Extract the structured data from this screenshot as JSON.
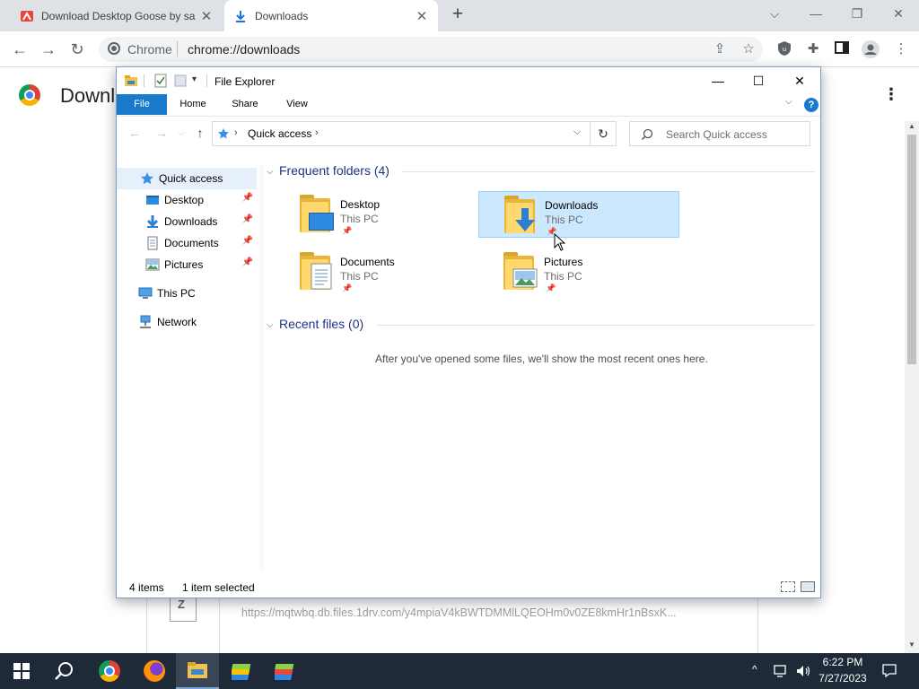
{
  "browser": {
    "tabs": [
      {
        "title": "Download Desktop Goose by sa",
        "close": "✕"
      },
      {
        "title": "Downloads",
        "close": "✕"
      }
    ],
    "new_tab": "+",
    "window_controls": {
      "dropdown": "⌵",
      "minimize": "—",
      "restore": "❐",
      "close": "✕"
    },
    "omnibox": {
      "site_label": "Chrome",
      "url": "chrome://downloads"
    }
  },
  "downloads_page": {
    "title": "Downloads",
    "item_url": "https://mqtwbq.db.files.1drv.com/y4mpiaV4kBWTDMMlLQEOHm0v0ZE8kmHr1nBsxK...",
    "file_icon_letter": "Z"
  },
  "explorer": {
    "title": "File Explorer",
    "window_controls": {
      "minimize": "—",
      "maximize": "☐",
      "close": "✕"
    },
    "ribbon": {
      "tabs": [
        "File",
        "Home",
        "Share",
        "View"
      ],
      "help": "?"
    },
    "address": {
      "location": "Quick access",
      "search_placeholder": "Search Quick access"
    },
    "nav": {
      "quick_access": "Quick access",
      "pinned": [
        "Desktop",
        "Downloads",
        "Documents",
        "Pictures"
      ],
      "this_pc": "This PC",
      "network": "Network"
    },
    "frequent": {
      "header": "Frequent folders (4)",
      "folders": [
        {
          "name": "Desktop",
          "location": "This PC"
        },
        {
          "name": "Downloads",
          "location": "This PC"
        },
        {
          "name": "Documents",
          "location": "This PC"
        },
        {
          "name": "Pictures",
          "location": "This PC"
        }
      ]
    },
    "recent": {
      "header": "Recent files (0)",
      "empty_message": "After you've opened some files, we'll show the most recent ones here."
    },
    "status": {
      "items": "4 items",
      "selected": "1 item selected"
    }
  },
  "taskbar": {
    "time": "6:22 PM",
    "date": "7/27/2023",
    "icons": [
      "windows-start-icon",
      "search-icon",
      "chrome-icon",
      "firefox-icon",
      "file-explorer-icon",
      "bluestacks-icon",
      "bluestacks-multi-icon"
    ]
  },
  "colors": {
    "accent": "#1979ca",
    "selection": "#cce8ff",
    "folder": "#ffd86e",
    "taskbar": "#1f2a38"
  }
}
